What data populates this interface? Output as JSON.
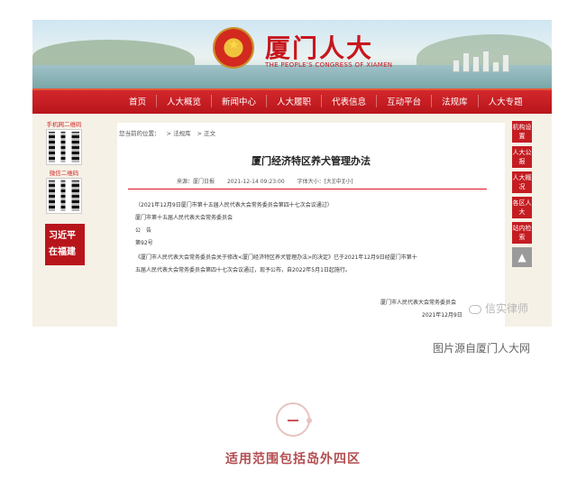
{
  "screenshot": {
    "brand": {
      "title": "厦门人大",
      "subtitle": "THE PEOPLE'S CONGRESS OF XIAMEN"
    },
    "nav": [
      "首页",
      "人大概览",
      "新闻中心",
      "人大履职",
      "代表信息",
      "互动平台",
      "法规库",
      "人大专题"
    ],
    "left": {
      "qr1_label": "手机网二维码",
      "qr2_label": "微信二维码",
      "banner_text": [
        "习近平",
        "在福建"
      ]
    },
    "right": {
      "buttons": [
        "机构设置",
        "人大公报",
        "人大概况",
        "各区人大",
        "站内检索"
      ],
      "top_arrow": "▲"
    },
    "breadcrumb": [
      "您当前的位置：",
      "> 法规库",
      "> 正文"
    ],
    "article": {
      "title": "厦门经济特区养犬管理办法",
      "source": "来源：厦门日报",
      "date": "2021-12-14 09:23:00",
      "font_size": "字体大小：[大][中][小]",
      "lines": [
        "（2021年12月9日厦门市第十五届人民代表大会常务委员会第四十七次会议通过）",
        "厦门市第十五届人民代表大会常务委员会",
        "公　告",
        "第92号",
        "《厦门市人民代表大会常务委员会关于修改<厦门经济特区养犬管理办法>的决定》已于2021年12月9日经厦门市第十",
        "五届人民代表大会常务委员会第四十七次会议通过，现予公布，自2022年5月1日起施行。"
      ],
      "signature": "厦门市人民代表大会常务委员会",
      "sign_date": "2021年12月9日"
    }
  },
  "watermark": "信实律师",
  "caption": "图片源自厦门人大网",
  "section_number": "一",
  "section_title": "适用范围包括岛外四区"
}
